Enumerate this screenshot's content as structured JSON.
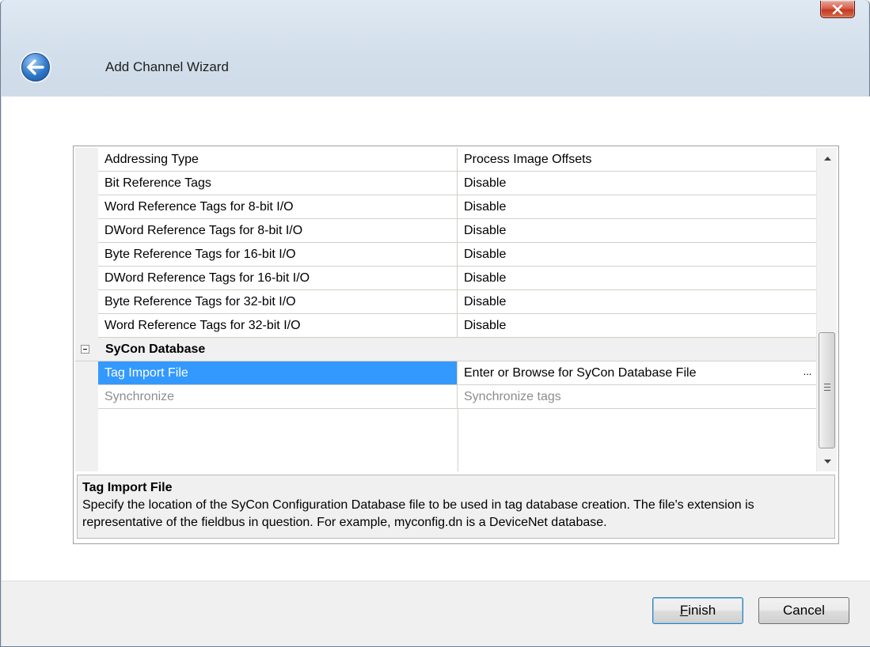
{
  "window": {
    "title": "Add Channel Wizard",
    "close_icon": "close-icon",
    "back_icon": "back-arrow-icon"
  },
  "properties": {
    "rows": [
      {
        "name": "Addressing Type",
        "value": "Process Image Offsets"
      },
      {
        "name": "Bit Reference Tags",
        "value": "Disable"
      },
      {
        "name": "Word Reference Tags for 8-bit I/O",
        "value": "Disable"
      },
      {
        "name": "DWord Reference Tags for 8-bit I/O",
        "value": "Disable"
      },
      {
        "name": "Byte Reference Tags for 16-bit I/O",
        "value": "Disable"
      },
      {
        "name": "DWord Reference Tags for 16-bit I/O",
        "value": "Disable"
      },
      {
        "name": "Byte Reference Tags for 32-bit I/O",
        "value": "Disable"
      },
      {
        "name": "Word Reference Tags for 32-bit I/O",
        "value": "Disable"
      }
    ],
    "category": {
      "label": "SyCon Database",
      "expanded": true
    },
    "category_rows": [
      {
        "name": "Tag Import File",
        "value": "Enter or Browse for SyCon Database File",
        "selected": true,
        "browse_label": "..."
      },
      {
        "name": "Synchronize",
        "value": "Synchronize tags",
        "disabled": true
      }
    ]
  },
  "help": {
    "title": "Tag Import File",
    "description": "Specify the location of the SyCon Configuration Database file to be used in tag database creation. The file's extension is representative of the fieldbus in question. For example, myconfig.dn is a DeviceNet database."
  },
  "buttons": {
    "finish_label": "Finish",
    "finish_mnemonic": "F",
    "finish_rest": "inish",
    "cancel_label": "Cancel"
  },
  "colors": {
    "selection": "#3399ff",
    "close_button": "#c23a22",
    "disabled_text": "#8d8d8d"
  }
}
